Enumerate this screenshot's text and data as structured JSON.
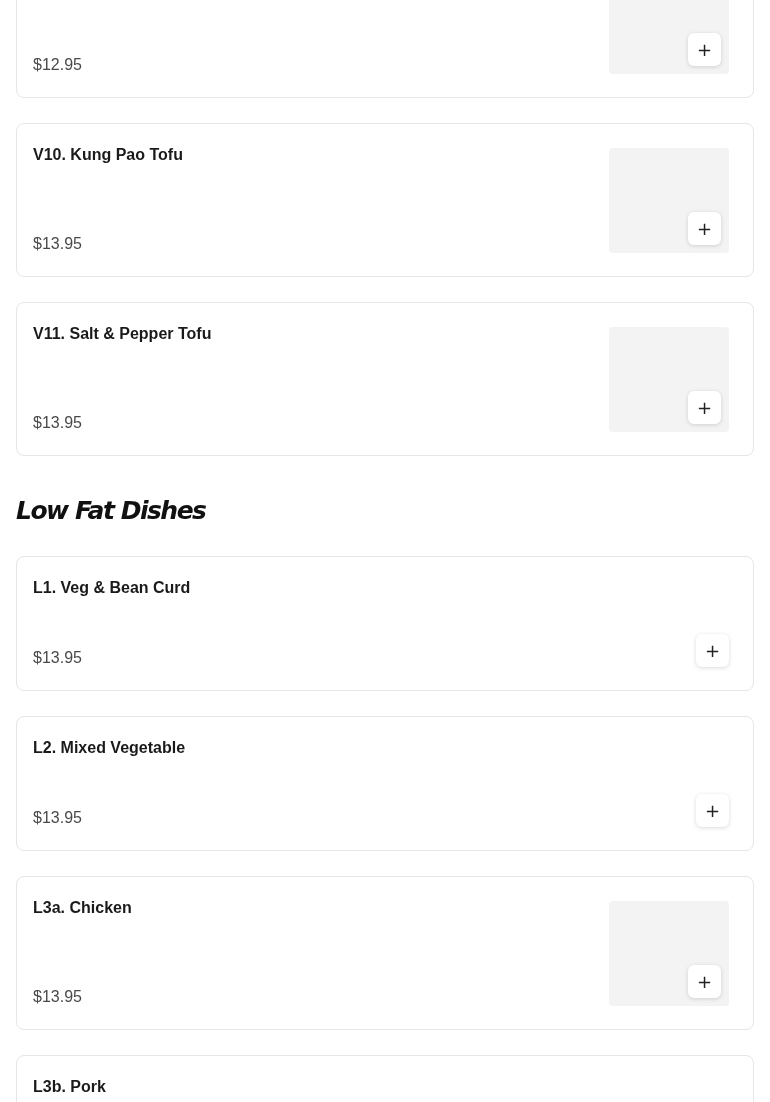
{
  "sections": [
    {
      "items": [
        {
          "kind": "with-image",
          "price": "$12.95",
          "add": "+"
        },
        {
          "kind": "with-image",
          "name": "V10. Kung Pao Tofu",
          "price": "$13.95",
          "add": "+"
        },
        {
          "kind": "with-image",
          "name": "V11. Salt & Pepper Tofu",
          "price": "$13.95",
          "add": "+"
        }
      ]
    },
    {
      "title": "Low Fat Dishes",
      "items": [
        {
          "kind": "plain",
          "name": "L1. Veg & Bean Curd",
          "price": "$13.95",
          "add": "+"
        },
        {
          "kind": "plain",
          "name": "L2. Mixed Vegetable",
          "price": "$13.95",
          "add": "+"
        },
        {
          "kind": "with-image",
          "name": "L3a. Chicken",
          "price": "$13.95",
          "add": "+"
        },
        {
          "kind": "plain",
          "name": "L3b. Pork"
        }
      ]
    }
  ]
}
